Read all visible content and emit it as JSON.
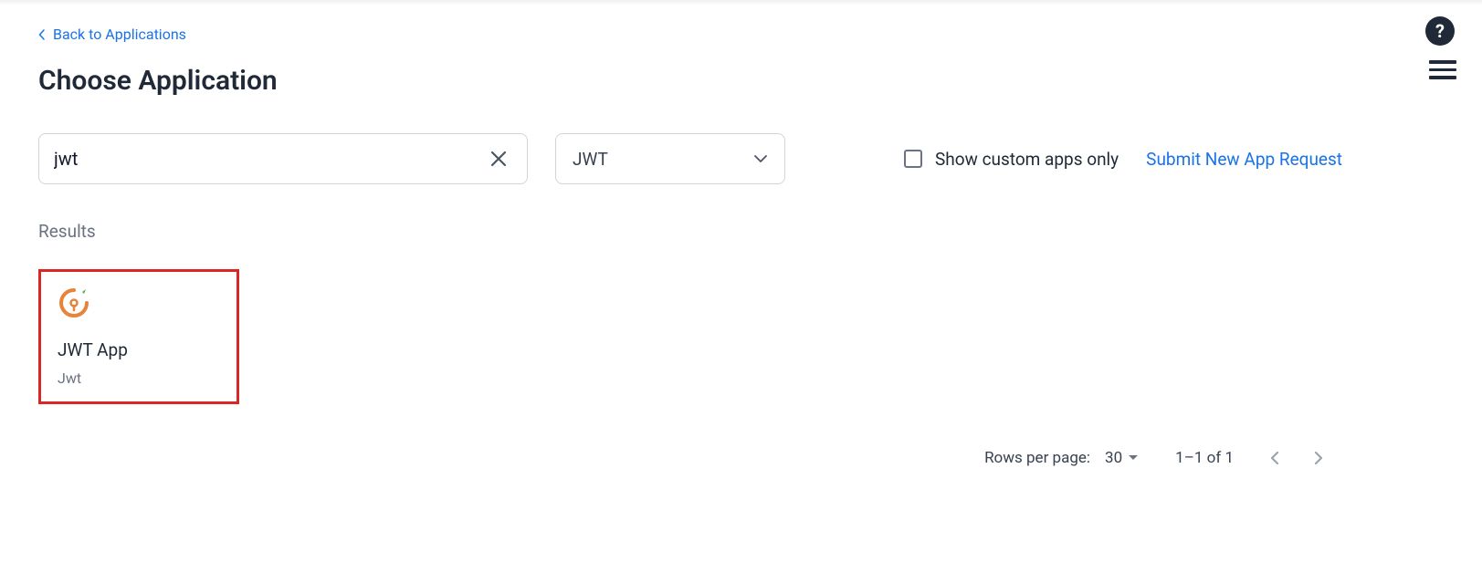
{
  "back_link": {
    "label": "Back to Applications"
  },
  "page_title": "Choose Application",
  "search": {
    "value": "jwt"
  },
  "filter_dropdown": {
    "selected": "JWT"
  },
  "custom_apps_checkbox": {
    "label": "Show custom apps only",
    "checked": false
  },
  "submit_request_link": "Submit New App Request",
  "results_label": "Results",
  "results": [
    {
      "title": "JWT App",
      "subtitle": "Jwt"
    }
  ],
  "pagination": {
    "rows_label": "Rows per page:",
    "rows_value": "30",
    "range": "1–1 of 1"
  }
}
